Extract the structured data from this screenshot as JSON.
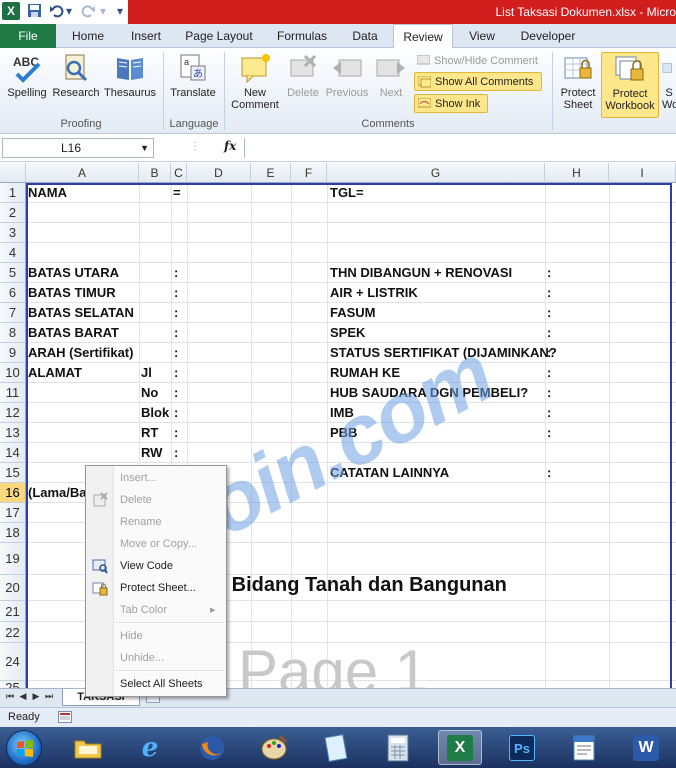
{
  "window": {
    "title": "List Taksasi Dokumen.xlsx - Micro"
  },
  "qat": {
    "excel_icon": "X",
    "save_icon": "save-icon",
    "undo_icon": "undo-icon",
    "redo_icon": "redo-icon"
  },
  "tabs": {
    "file": "File",
    "items": [
      "Home",
      "Insert",
      "Page Layout",
      "Formulas",
      "Data",
      "Review",
      "View",
      "Developer"
    ],
    "active": "Review"
  },
  "ribbon": {
    "proofing": {
      "label": "Proofing",
      "spelling": "Spelling",
      "research": "Research",
      "thesaurus": "Thesaurus"
    },
    "language": {
      "label": "Language",
      "translate": "Translate"
    },
    "comments": {
      "label": "Comments",
      "new_comment_l1": "New",
      "new_comment_l2": "Comment",
      "delete": "Delete",
      "previous": "Previous",
      "next": "Next",
      "show_hide": "Show/Hide Comment",
      "show_all": "Show All Comments",
      "show_ink": "Show Ink"
    },
    "changes": {
      "protect_sheet_l1": "Protect",
      "protect_sheet_l2": "Sheet",
      "protect_workbook_l1": "Protect",
      "protect_workbook_l2": "Workbook",
      "share_l1": "S",
      "share_l2": "Wo"
    }
  },
  "formula_bar": {
    "name_box": "L16",
    "fx": "fx",
    "formula": ""
  },
  "columns": [
    "A",
    "B",
    "C",
    "D",
    "E",
    "F",
    "G",
    "H",
    "I"
  ],
  "rows": [
    "1",
    "2",
    "3",
    "4",
    "5",
    "6",
    "7",
    "8",
    "9",
    "10",
    "11",
    "12",
    "13",
    "14",
    "15",
    "16",
    "17",
    "18",
    "19",
    "20",
    "21",
    "22",
    "24",
    "25"
  ],
  "selected_row": "16",
  "cells": {
    "a1": "NAMA",
    "c1": "=",
    "g1": "TGL=",
    "a5": "BATAS UTARA",
    "c5": ":",
    "g5": "THN DIBANGUN + RENOVASI",
    "h5": ":",
    "a6": "BATAS TIMUR",
    "c6": ":",
    "g6": "AIR + LISTRIK",
    "h6": ":",
    "a7": "BATAS SELATAN",
    "c7": ":",
    "g7": "FASUM",
    "h7": ":",
    "a8": "BATAS BARAT",
    "c8": ":",
    "g8": "SPEK",
    "h8": ":",
    "a9": "ARAH (Sertifikat)",
    "c9": ":",
    "g9": "STATUS SERTIFIKAT (DIJAMINKAN?",
    "h9": ":",
    "a10": "ALAMAT",
    "b10": "Jl",
    "c10": ":",
    "g10": "RUMAH KE",
    "h10": ":",
    "b11": "No",
    "c11": ":",
    "g11": "HUB SAUDARA DGN PEMBELI?",
    "h11": ":",
    "b12": "Blok",
    "c12": ":",
    "g12": "IMB",
    "h12": ":",
    "b13": "RT",
    "c13": ":",
    "g13": "PBB",
    "h13": ":",
    "b14": "RW",
    "c14": ":",
    "g15": "CATATAN LAINNYA",
    "h15": ":",
    "a16": "(Lama/Ba"
  },
  "sheet_title_partial": "s Bidang Tanah dan Bangunan",
  "page_watermark": "Page 1",
  "site_watermark": "ITPoin.com",
  "sheet_tab": "TAKSASI",
  "status": "Ready",
  "context_menu": {
    "items": [
      {
        "label": "Insert...",
        "enabled": false
      },
      {
        "label": "Delete",
        "enabled": false
      },
      {
        "label": "Rename",
        "enabled": false
      },
      {
        "label": "Move or Copy...",
        "enabled": false
      },
      {
        "label": "View Code",
        "enabled": true
      },
      {
        "label": "Protect Sheet...",
        "enabled": true
      },
      {
        "label": "Tab Color",
        "enabled": false
      },
      {
        "label": "Hide",
        "enabled": false
      },
      {
        "label": "Unhide...",
        "enabled": false
      },
      {
        "label": "Select All Sheets",
        "enabled": true
      }
    ],
    "submenu_arrow": "▸"
  },
  "taskbar": {
    "apps": [
      "windows-explorer",
      "internet-explorer",
      "firefox",
      "paint",
      "notepad",
      "calculator",
      "excel",
      "photoshop",
      "wordpad",
      "word"
    ],
    "active": "excel",
    "labels": {
      "photoshop": "Ps",
      "excel": "X",
      "word": "W",
      "ie": "e"
    }
  }
}
